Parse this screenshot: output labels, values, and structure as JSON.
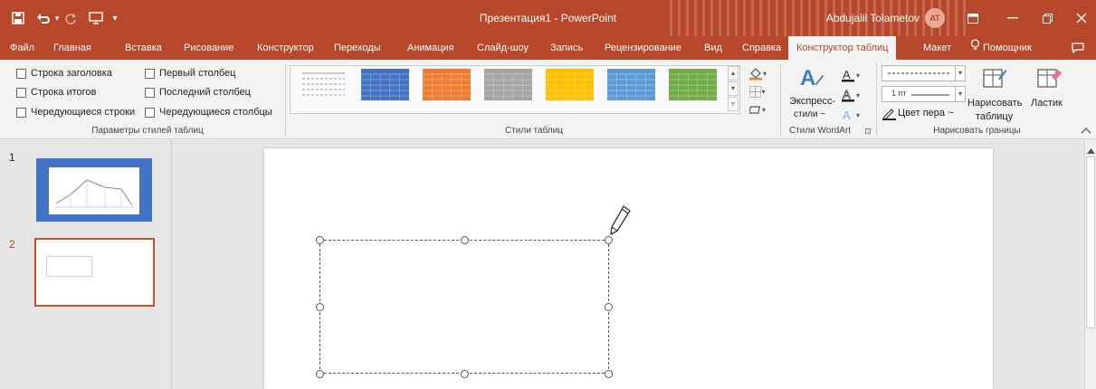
{
  "app": {
    "title": "Презентация1  -  PowerPoint",
    "user_name": "Abdujalil Tolametov",
    "user_initials": "AT",
    "accent_color": "#b7472a"
  },
  "quick_access": [
    {
      "name": "save-icon",
      "glyph": "🖫"
    },
    {
      "name": "undo-icon",
      "glyph": "↶"
    },
    {
      "name": "redo-icon",
      "glyph": "↻"
    },
    {
      "name": "present-icon",
      "glyph": "🖵"
    },
    {
      "name": "customize-icon",
      "glyph": "▾"
    }
  ],
  "tabs": [
    "Файл",
    "Главная",
    "Вставка",
    "Рисование",
    "Конструктор",
    "Переходы",
    "Анимация",
    "Слайд-шоу",
    "Запись",
    "Рецензирование",
    "Вид",
    "Справка",
    "Конструктор таблиц",
    "Макет",
    "Помощник"
  ],
  "active_tab": "Конструктор таблиц",
  "ribbon": {
    "style_options": {
      "items": [
        {
          "label": "Строка заголовка",
          "checked": false
        },
        {
          "label": "Строка итогов",
          "checked": false
        },
        {
          "label": "Чередующиеся строки",
          "checked": false
        },
        {
          "label": "Первый столбец",
          "checked": false
        },
        {
          "label": "Последний столбец",
          "checked": false
        },
        {
          "label": "Чередующиеся столбцы",
          "checked": false
        }
      ],
      "group_label": "Параметры стилей таблиц"
    },
    "table_styles": {
      "group_label": "Стили таблиц",
      "swatches": [
        {
          "color": "#ffffff",
          "line": "#9a9a9a"
        },
        {
          "color": "#4472c4",
          "line": "#8eaadb"
        },
        {
          "color": "#ed7d31",
          "line": "#f4b183"
        },
        {
          "color": "#a5a5a5",
          "line": "#c9c9c9"
        },
        {
          "color": "#ffc000",
          "line": "#ffd966"
        },
        {
          "color": "#5b9bd5",
          "line": "#9dc3e6"
        },
        {
          "color": "#70ad47",
          "line": "#a9d18e"
        }
      ]
    },
    "wordart": {
      "quick_styles_line1": "Экспресс-",
      "quick_styles_line2": "стили ~",
      "group_label": "Стили WordArt"
    },
    "borders": {
      "pen_weight": "1 пт",
      "pen_color": "Цвет пера ~",
      "draw_table_line1": "Нарисовать",
      "draw_table_line2": "таблицу",
      "eraser": "Ластик",
      "group_label": "Нарисовать границы"
    }
  },
  "slides": [
    {
      "number": "1",
      "selected": false
    },
    {
      "number": "2",
      "selected": true
    }
  ]
}
